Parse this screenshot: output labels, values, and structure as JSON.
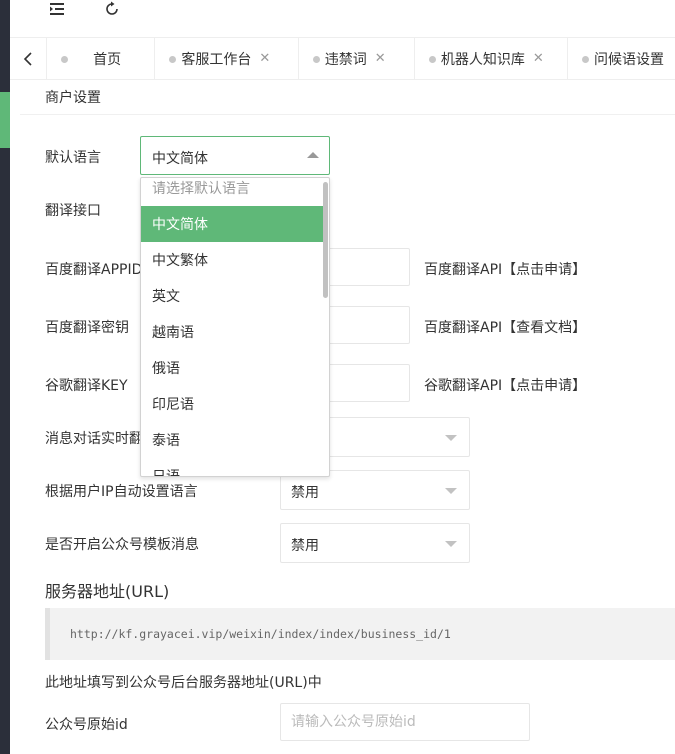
{
  "tabs": [
    {
      "label": "首页",
      "closable": false
    },
    {
      "label": "客服工作台",
      "closable": true
    },
    {
      "label": "违禁词",
      "closable": true
    },
    {
      "label": "机器人知识库",
      "closable": true
    },
    {
      "label": "问候语设置",
      "closable": false
    }
  ],
  "tab_close_glyph": "✕",
  "section_title": "商户设置",
  "form": {
    "default_language_label": "默认语言",
    "default_language_value": "中文简体",
    "translate_api_label": "翻译接口",
    "baidu_appid_label": "百度翻译APPID",
    "baidu_appid_link": "百度翻译API【点击申请】",
    "baidu_secret_label": "百度翻译密钥",
    "baidu_secret_link": "百度翻译API【查看文档】",
    "google_key_label": "谷歌翻译KEY",
    "google_key_link": "谷歌翻译API【点击申请】",
    "realtime_translate_label": "消息对话实时翻译",
    "ip_auto_lang_label": "根据用户IP自动设置语言",
    "ip_auto_lang_value": "禁用",
    "wechat_template_label": "是否开启公众号模板消息",
    "wechat_template_value": "禁用"
  },
  "dropdown": {
    "placeholder": "请选择默认语言",
    "options": [
      "中文简体",
      "中文繁体",
      "英文",
      "越南语",
      "俄语",
      "印尼语",
      "泰语",
      "日语"
    ],
    "selected_index": 0
  },
  "server_url_title": "服务器地址(URL)",
  "server_url": "http://kf.grayacei.vip/weixin/index/index/business_id/1",
  "server_url_note": "此地址填写到公众号后台服务器地址(URL)中",
  "wechat_original_id_label": "公众号原始id",
  "wechat_original_id_placeholder": "请输入公众号原始id",
  "colors": {
    "accent": "#5fb878",
    "sidebar": "#2b2f3a"
  }
}
